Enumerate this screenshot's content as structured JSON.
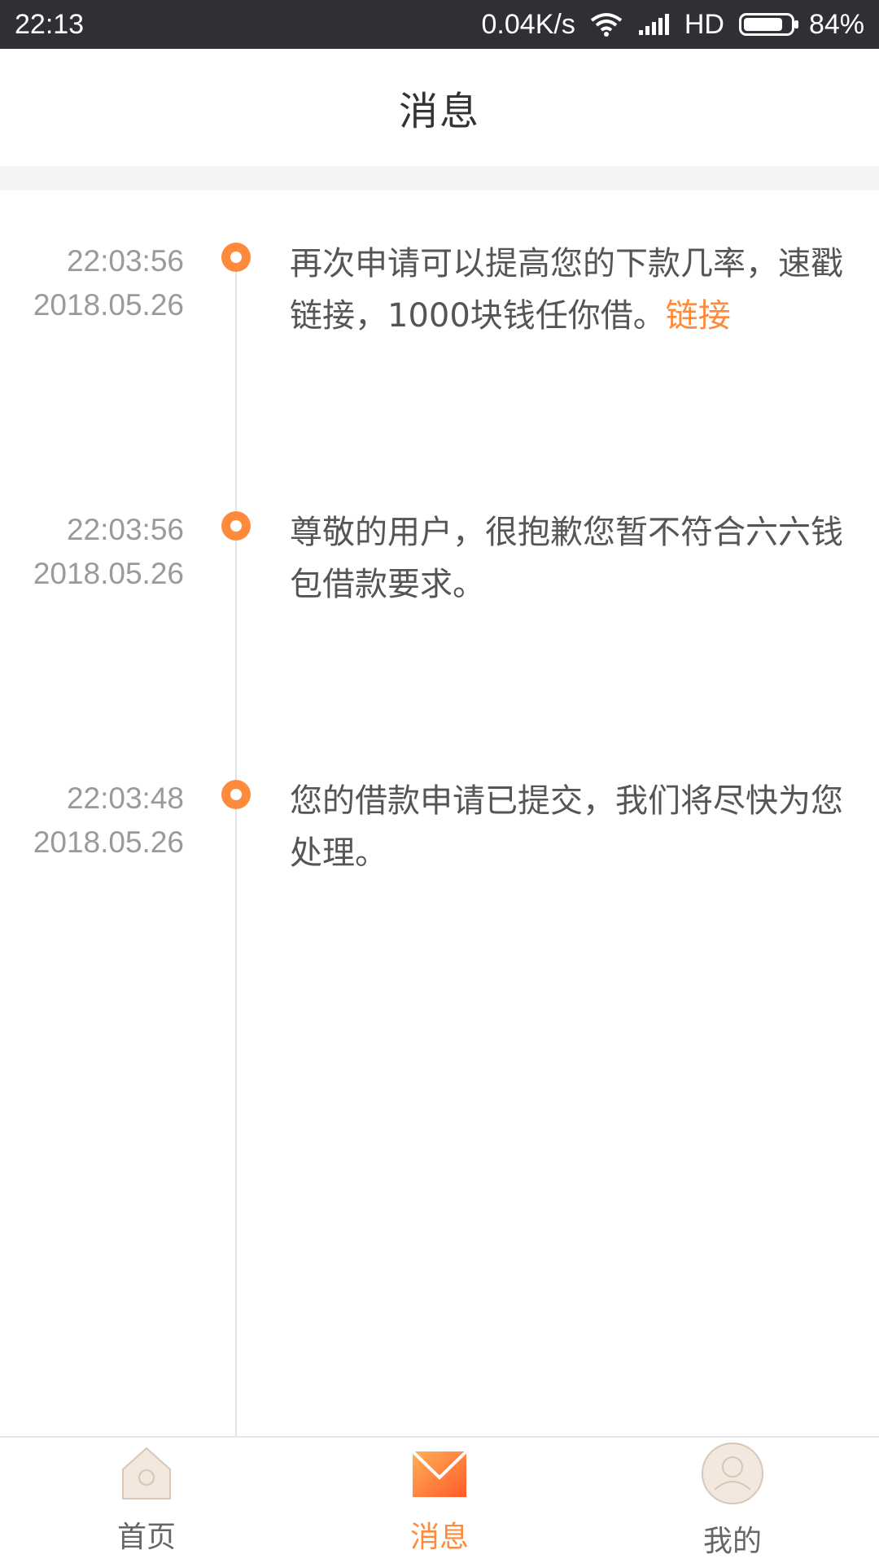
{
  "status_bar": {
    "time": "22:13",
    "network_speed": "0.04K/s",
    "network_type": "HD",
    "battery": "84%",
    "battery_level": 0.84
  },
  "header": {
    "title": "消息"
  },
  "messages": [
    {
      "time": "22:03:56",
      "date": "2018.05.26",
      "text": "再次申请可以提高您的下款几率，速戳 链接，1000块钱任你借。",
      "link": "链接"
    },
    {
      "time": "22:03:56",
      "date": "2018.05.26",
      "text": "尊敬的用户，很抱歉您暂不符合六六钱包借款要求。"
    },
    {
      "time": "22:03:48",
      "date": "2018.05.26",
      "text": "您的借款申请已提交，我们将尽快为您处理。"
    }
  ],
  "tab_bar": {
    "tabs": [
      {
        "label": "首页",
        "icon": "home-icon",
        "active": false
      },
      {
        "label": "消息",
        "icon": "mail-icon",
        "active": true
      },
      {
        "label": "我的",
        "icon": "profile-icon",
        "active": false
      }
    ]
  },
  "colors": {
    "accent": "#ff8a3c",
    "status_bar_bg": "#2f3033",
    "timestamp": "#9a9a9a",
    "body_text": "#555555"
  }
}
